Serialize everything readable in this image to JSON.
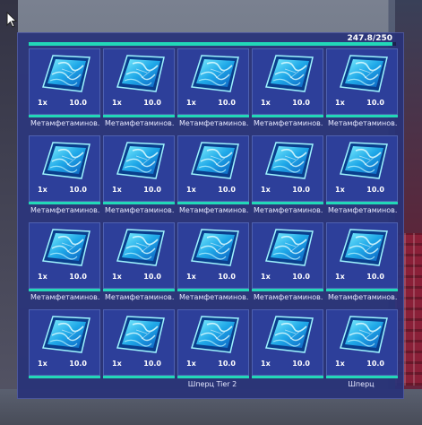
{
  "inventory": {
    "weight": {
      "text": "247.8/250",
      "fraction": 0.991
    },
    "accent_color": "#22d8b8",
    "item_icon": "crystal-tray-icon",
    "slots": [
      {
        "qty": "1x",
        "weight": "10.0",
        "name": "Метамфетаминов..."
      },
      {
        "qty": "1x",
        "weight": "10.0",
        "name": "Метамфетаминов..."
      },
      {
        "qty": "1x",
        "weight": "10.0",
        "name": "Метамфетаминов..."
      },
      {
        "qty": "1x",
        "weight": "10.0",
        "name": "Метамфетаминов..."
      },
      {
        "qty": "1x",
        "weight": "10.0",
        "name": "Метамфетаминов..."
      },
      {
        "qty": "1x",
        "weight": "10.0",
        "name": "Метамфетаминов..."
      },
      {
        "qty": "1x",
        "weight": "10.0",
        "name": "Метамфетаминов..."
      },
      {
        "qty": "1x",
        "weight": "10.0",
        "name": "Метамфетаминов..."
      },
      {
        "qty": "1x",
        "weight": "10.0",
        "name": "Метамфетаминов..."
      },
      {
        "qty": "1x",
        "weight": "10.0",
        "name": "Метамфетаминов..."
      },
      {
        "qty": "1x",
        "weight": "10.0",
        "name": "Метамфетаминов..."
      },
      {
        "qty": "1x",
        "weight": "10.0",
        "name": "Метамфетаминов..."
      },
      {
        "qty": "1x",
        "weight": "10.0",
        "name": "Метамфетаминов..."
      },
      {
        "qty": "1x",
        "weight": "10.0",
        "name": "Метамфетаминов..."
      },
      {
        "qty": "1x",
        "weight": "10.0",
        "name": "Метамфетаминов..."
      },
      {
        "qty": "1x",
        "weight": "10.0",
        "name": ""
      },
      {
        "qty": "1x",
        "weight": "10.0",
        "name": ""
      },
      {
        "qty": "1x",
        "weight": "10.0",
        "name": "Шперц Tier 2"
      },
      {
        "qty": "1x",
        "weight": "10.0",
        "name": ""
      },
      {
        "qty": "1x",
        "weight": "10.0",
        "name": "Шперц"
      }
    ]
  }
}
